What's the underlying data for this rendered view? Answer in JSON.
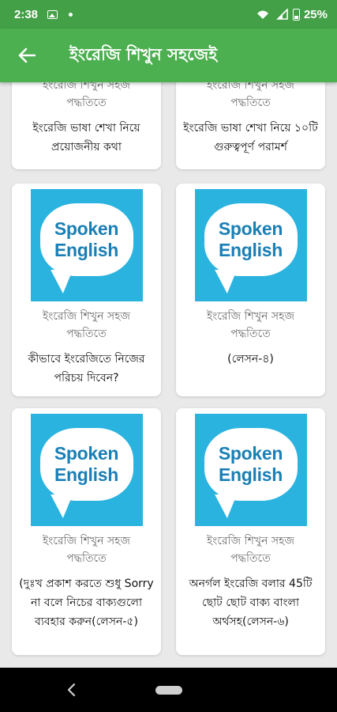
{
  "status_bar": {
    "time": "2:38",
    "battery": "25%"
  },
  "app_bar": {
    "title": "ইংরেজি শিখুন সহজেই"
  },
  "cards": [
    {
      "subtitle_line1": "ইংরেজি শিখুন সহজ",
      "subtitle_line2": "পদ্ধতিতে",
      "title": "ইংরেজি ভাষা শেখা নিয়ে প্রয়োজনীয় কথা"
    },
    {
      "subtitle_line1": "ইংরেজি শিখুন সহজ",
      "subtitle_line2": "পদ্ধতিতে",
      "title": "ইংরেজি ভাষা শেখা নিয়ে ১০টি গুরুত্বপূর্ণ পরামর্শ"
    },
    {
      "thumb_line1": "Spoken",
      "thumb_line2": "English",
      "subtitle_line1": "ইংরেজি শিখুন সহজ",
      "subtitle_line2": "পদ্ধতিতে",
      "title": "কীভাবে ইংরেজিতে নিজের পরিচয় দিবেন?"
    },
    {
      "thumb_line1": "Spoken",
      "thumb_line2": "English",
      "subtitle_line1": "ইংরেজি শিখুন সহজ",
      "subtitle_line2": "পদ্ধতিতে",
      "title": "(লেসন-৪)"
    },
    {
      "thumb_line1": "Spoken",
      "thumb_line2": "English",
      "subtitle_line1": "ইংরেজি শিখুন সহজ",
      "subtitle_line2": "পদ্ধতিতে",
      "title": "(দুঃখ প্রকাশ করতে শুধু Sorry না বলে নিচের বাক্যগুলো ব্যবহার করুন(লেসন-৫)"
    },
    {
      "thumb_line1": "Spoken",
      "thumb_line2": "English",
      "subtitle_line1": "ইংরেজি শিখুন সহজ",
      "subtitle_line2": "পদ্ধতিতে",
      "title": "অনর্গল ইংরেজি বলার 45টি ছোট ছোট বাক্য বাংলা অর্থসহ(লেসন-৬)"
    }
  ],
  "colors": {
    "status_bar": "#43a047",
    "app_bar": "#4caf50",
    "thumb_bg": "#2bb3e0",
    "thumb_text": "#1a7fb5"
  },
  "icons": {
    "back": "arrow-left-icon",
    "nav_back": "chevron-left-icon",
    "nav_home": "home-pill-icon"
  }
}
